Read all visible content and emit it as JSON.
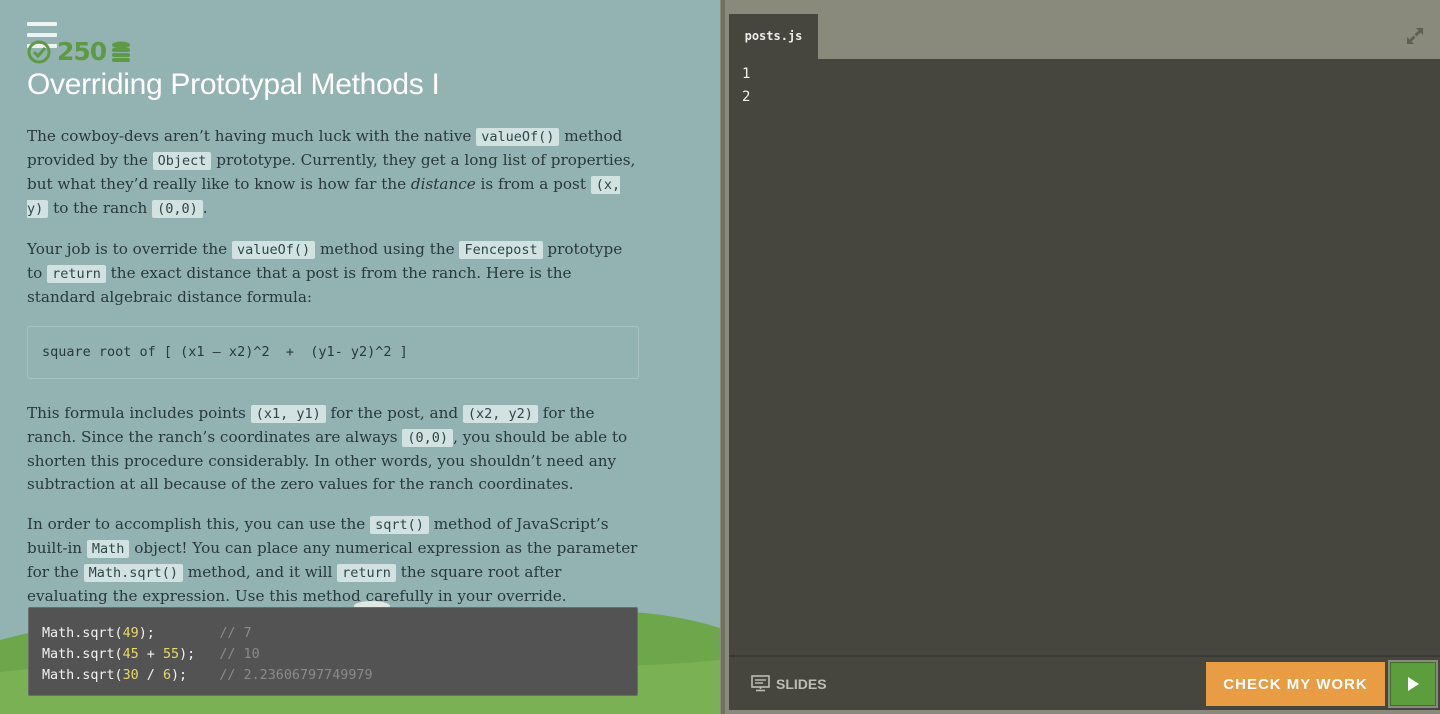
{
  "header": {
    "points": "250",
    "title": "Overriding Prototypal Methods I"
  },
  "instructions": {
    "p1": {
      "t1": "The cowboy-devs aren’t having much luck with the native ",
      "c1": "valueOf()",
      "t2": " method provided by the ",
      "c2": "Object",
      "t3": " prototype. Currently, they get a long list of properties, but what they’d really like to know is how far the ",
      "em1": "distance",
      "t4": " is from a post ",
      "c3": "(x, y)",
      "t5": " to the ranch ",
      "c4": "(0,0)",
      "t6": "."
    },
    "p2": {
      "t1": "Your job is to override the ",
      "c1": "valueOf()",
      "t2": " method using the ",
      "c2": "Fencepost",
      "t3": " prototype to ",
      "c3": "return",
      "t4": " the exact distance that a post is from the ranch. Here is the standard algebraic distance formula:"
    },
    "formula": "square root of [ (x1 – x2)^2  +  (y1- y2)^2 ]",
    "p3": {
      "t1": "This formula includes points ",
      "c1": "(x1, y1)",
      "t2": " for the post, and ",
      "c2": "(x2, y2)",
      "t3": " for the ranch. Since the ranch’s coordinates are always ",
      "c3": "(0,0)",
      "t4": ", you should be able to shorten this procedure considerably. In other words, you shouldn’t need any subtraction at all because of the zero values for the ranch coordinates."
    },
    "p4": {
      "t1": "In order to accomplish this, you can use the ",
      "c1": "sqrt()",
      "t2": " method of JavaScript’s built-in ",
      "c2": "Math",
      "t3": " object! You can place any numerical expression as the parameter for the ",
      "c3": "Math.sqrt()",
      "t4": " method, and it will ",
      "c4": "return",
      "t5": " the square root after evaluating the expression. Use this method carefully in your override."
    },
    "example": [
      {
        "pre": "Math.sqrt(",
        "n1": "49",
        "op": "",
        "n2": "",
        "post": ");",
        "pad": "        ",
        "comment": "// 7"
      },
      {
        "pre": "Math.sqrt(",
        "n1": "45",
        "op": " + ",
        "n2": "55",
        "post": ");",
        "pad": "   ",
        "comment": "// 10"
      },
      {
        "pre": "Math.sqrt(",
        "n1": "30",
        "op": " / ",
        "n2": "6",
        "post": ");",
        "pad": "    ",
        "comment": "// 2.23606797749979"
      }
    ]
  },
  "editor": {
    "tab_label": "posts.js",
    "line_numbers": [
      "1",
      "2"
    ]
  },
  "footer": {
    "slides_label": "SLIDES",
    "check_label": "CHECK MY WORK"
  },
  "colors": {
    "accent_orange": "#e89c43",
    "run_green": "#5c9e3e",
    "points_green": "#5e9a43",
    "editor_bg": "#46463f",
    "left_bg": "#93b3b3"
  },
  "icons": {
    "menu": "hamburger-menu-icon",
    "points": "check-circle-icon",
    "coins": "coins-icon",
    "expand": "expand-icon",
    "slides": "presentation-icon",
    "run": "play-icon"
  }
}
